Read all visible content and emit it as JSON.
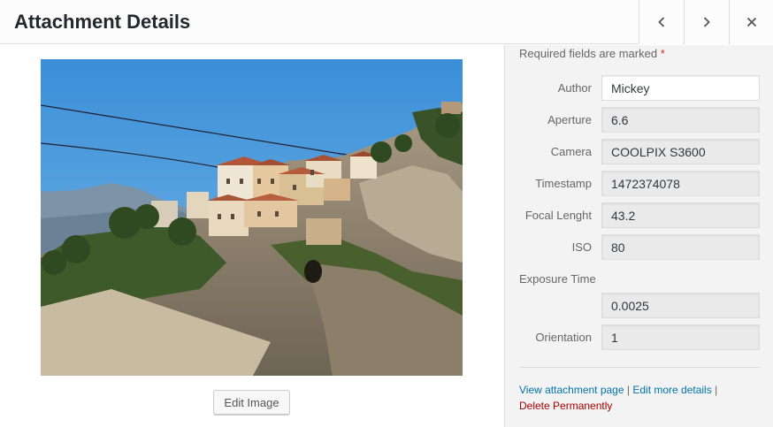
{
  "header": {
    "title": "Attachment Details",
    "prev_icon": "chevron-left-icon",
    "next_icon": "chevron-right-icon",
    "close_icon": "close-icon"
  },
  "main": {
    "edit_label": "Edit Image"
  },
  "sidebar": {
    "required_text": "Required fields are marked",
    "required_star": "*",
    "fields": {
      "author": {
        "label": "Author",
        "value": "Mickey"
      },
      "aperture": {
        "label": "Aperture",
        "value": "6.6"
      },
      "camera": {
        "label": "Camera",
        "value": "COOLPIX S3600"
      },
      "timestamp": {
        "label": "Timestamp",
        "value": "1472374078"
      },
      "focal": {
        "label": "Focal Lenght",
        "value": "43.2"
      },
      "iso": {
        "label": "ISO",
        "value": "80"
      },
      "exposure": {
        "label": "Exposure Time",
        "value": "0.0025"
      },
      "orientation": {
        "label": "Orientation",
        "value": "1"
      }
    },
    "links": {
      "view": "View attachment page",
      "sep1": "|",
      "edit": "Edit more details",
      "sep2": "|",
      "delete": "Delete Permanently"
    }
  },
  "colors": {
    "accent_link": "#0073aa",
    "danger": "#a00000",
    "required_star": "#dc3232"
  }
}
